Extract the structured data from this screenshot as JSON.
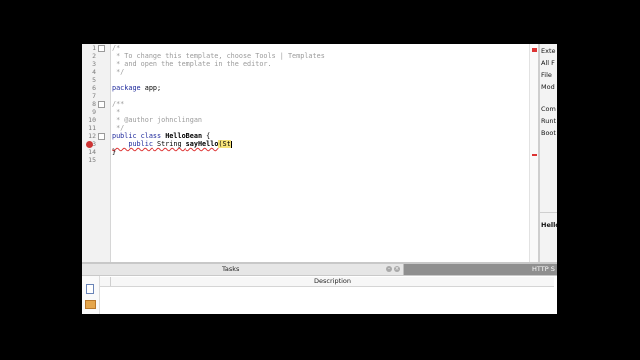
{
  "editor": {
    "line_numbers": [
      "1",
      "2",
      "3",
      "4",
      "5",
      "6",
      "7",
      "8",
      "9",
      "10",
      "11",
      "12",
      "13",
      "14",
      "15"
    ],
    "lines": {
      "l1": "/*",
      "l2": " * To change this template, choose Tools | Templates",
      "l3": " * and open the template in the editor.",
      "l4": " */",
      "l6_kw": "package",
      "l6_rest": " app;",
      "l8": "/**",
      "l9": " *",
      "l10": " * @author johnclingan",
      "l11": " */",
      "l12_kw": "public class",
      "l12_name": " HelloBean",
      "l12_rest": " {",
      "l13_kw": "    public",
      "l13_type": " String ",
      "l13_name": "sayHello",
      "l13_paren": "(St",
      "l14": "}"
    }
  },
  "right_panel": {
    "items": [
      "Exte",
      "All F",
      "File",
      "Mod",
      "Com",
      "Runt",
      "Boot"
    ],
    "bottom_label": "Hello"
  },
  "bottom_panel": {
    "tasks_tab": "Tasks",
    "http_tab": "HTTP S",
    "column_description": "Description"
  }
}
